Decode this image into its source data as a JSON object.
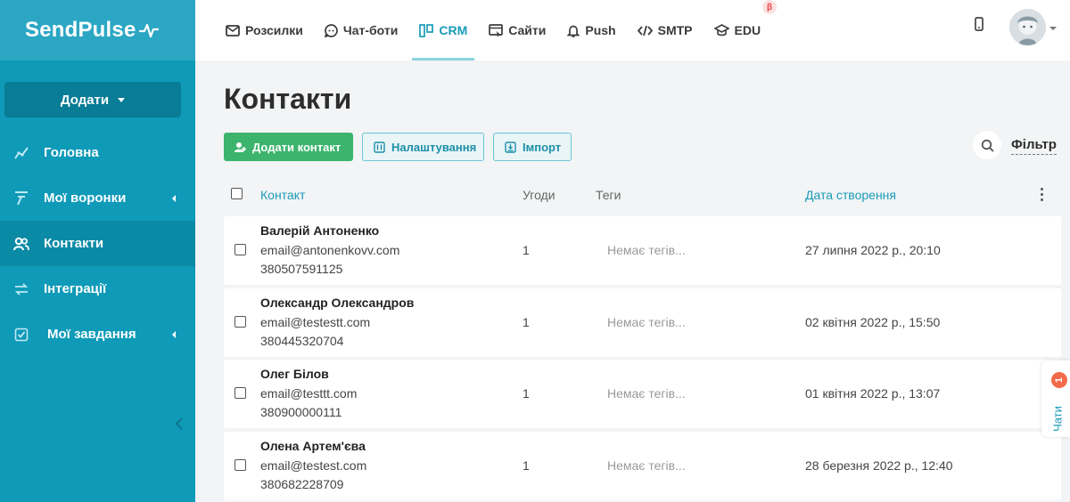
{
  "brand": {
    "name": "SendPulse"
  },
  "sidebar": {
    "add_label": "Додати",
    "items": [
      {
        "label": "Головна",
        "icon": "chart-line-icon",
        "has_arrow": false
      },
      {
        "label": "Мої воронки",
        "icon": "funnel-icon",
        "has_arrow": true
      },
      {
        "label": "Контакти",
        "icon": "contacts-icon",
        "has_arrow": false,
        "active": true
      },
      {
        "label": "Інтеграції",
        "icon": "arrows-swap-icon",
        "has_arrow": false
      },
      {
        "label": "Мої завдання",
        "icon": "checkbox-icon",
        "has_arrow": true
      }
    ]
  },
  "topnav": {
    "tabs": [
      {
        "label": "Розсилки",
        "icon": "mail-icon"
      },
      {
        "label": "Чат-боти",
        "icon": "chat-bot-icon"
      },
      {
        "label": "CRM",
        "icon": "crm-icon",
        "active": true
      },
      {
        "label": "Сайти",
        "icon": "website-icon"
      },
      {
        "label": "Push",
        "icon": "bell-icon"
      },
      {
        "label": "SMTP",
        "icon": "code-icon"
      },
      {
        "label": "EDU",
        "icon": "graduation-cap-icon",
        "badge": "β"
      }
    ]
  },
  "page": {
    "title": "Контакти",
    "add_contact_label": "Додати контакт",
    "settings_label": "Налаштування",
    "import_label": "Імпорт",
    "filter_label": "Фільтр"
  },
  "table": {
    "columns": {
      "contact": "Контакт",
      "deals": "Угоди",
      "tags": "Теги",
      "created": "Дата створення"
    },
    "rows": [
      {
        "name": "Валерій Антоненко",
        "email": "email@antonenkovv.com",
        "phone": "380507591125",
        "deals": "1",
        "tags": "Немає тегів...",
        "created": "27 липня 2022 р., 20:10"
      },
      {
        "name": "Олександр Олександров",
        "email": "email@testestt.com",
        "phone": "380445320704",
        "deals": "1",
        "tags": "Немає тегів...",
        "created": "02 квітня 2022 р., 15:50"
      },
      {
        "name": "Олег Білов",
        "email": "email@testtt.com",
        "phone": "380900000111",
        "deals": "1",
        "tags": "Немає тегів...",
        "created": "01 квітня 2022 р., 13:07"
      },
      {
        "name": "Олена Артем'єва",
        "email": "email@testest.com",
        "phone": "380682228709",
        "deals": "1",
        "tags": "Немає тегів...",
        "created": "28 березня 2022 р., 12:40"
      }
    ]
  },
  "chats": {
    "label": "Чати",
    "count": "1"
  },
  "colors": {
    "sidebar": "#0f9ab8",
    "accent": "#1a9bb8",
    "green": "#3cb46e"
  }
}
